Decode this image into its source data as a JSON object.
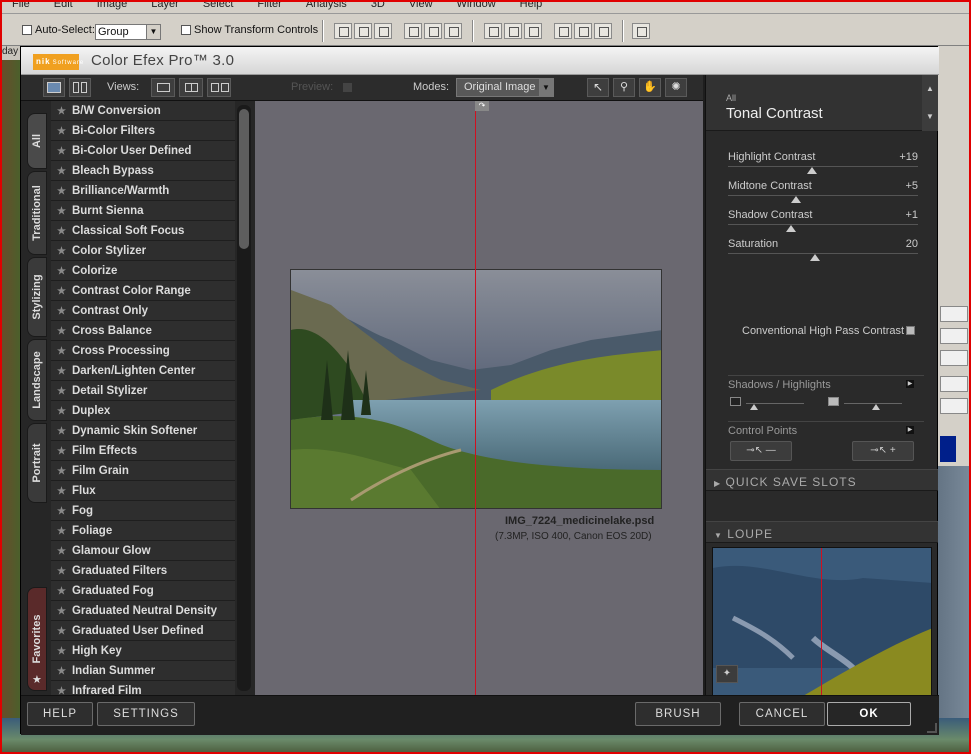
{
  "photoshop": {
    "menu_items": [
      "File",
      "Edit",
      "Image",
      "Layer",
      "Select",
      "Filter",
      "Analysis",
      "3D",
      "View",
      "Window",
      "Help"
    ],
    "auto_select_label": "Auto-Select:",
    "auto_select_value": "Group",
    "show_transform_label": "Show Transform Controls",
    "doc_tab_label": "day"
  },
  "dialog": {
    "logo_text": "nik",
    "logo_sub": "Software",
    "title": "Color Efex Pro™ 3.0"
  },
  "toolbar": {
    "views_label": "Views:",
    "preview_label": "Preview:",
    "modes_label": "Modes:",
    "modes_value": "Original Image"
  },
  "category_tabs": [
    "All",
    "Traditional",
    "Stylizing",
    "Landscape",
    "Portrait",
    "Favorites"
  ],
  "filters": [
    "B/W Conversion",
    "Bi-Color Filters",
    "Bi-Color User Defined",
    "Bleach Bypass",
    "Brilliance/Warmth",
    "Burnt Sienna",
    "Classical Soft Focus",
    "Color Stylizer",
    "Colorize",
    "Contrast Color Range",
    "Contrast Only",
    "Cross Balance",
    "Cross Processing",
    "Darken/Lighten Center",
    "Detail Stylizer",
    "Duplex",
    "Dynamic Skin Softener",
    "Film Effects",
    "Film Grain",
    "Flux",
    "Fog",
    "Foliage",
    "Glamour Glow",
    "Graduated Filters",
    "Graduated Fog",
    "Graduated Neutral Density",
    "Graduated User Defined",
    "High Key",
    "Indian Summer",
    "Infrared Film"
  ],
  "image_info": {
    "filename": "IMG_7224_medicinelake.psd",
    "details": "(7.3MP, ISO 400, Canon EOS 20D)"
  },
  "right_panel": {
    "category": "All",
    "filter_name": "Tonal Contrast",
    "sliders": [
      {
        "name": "Highlight Contrast",
        "value": "+19",
        "position": 0.44
      },
      {
        "name": "Midtone Contrast",
        "value": "+5",
        "position": 0.36
      },
      {
        "name": "Shadow Contrast",
        "value": "+1",
        "position": 0.33
      },
      {
        "name": "Saturation",
        "value": "20",
        "position": 0.46
      }
    ],
    "conventional_label": "Conventional High Pass Contrast",
    "shadows_highlights_label": "Shadows / Highlights",
    "control_points_label": "Control Points",
    "quick_save_label": "QUICK SAVE SLOTS",
    "loupe_label": "LOUPE"
  },
  "bottom": {
    "help": "HELP",
    "settings": "SETTINGS",
    "brush": "BRUSH",
    "cancel": "CANCEL",
    "ok": "OK"
  },
  "colors": {
    "accent_red": "#d01020",
    "logo_orange": "#f0a020",
    "panel_bg": "#2a2a2a"
  }
}
